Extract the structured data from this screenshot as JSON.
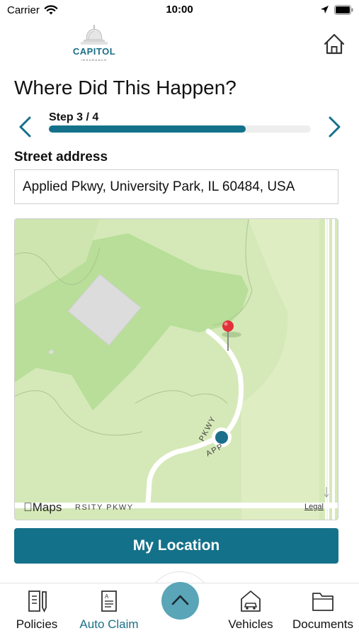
{
  "status_bar": {
    "carrier": "Carrier",
    "time": "10:00"
  },
  "header": {
    "logo_name": "CAPITOL",
    "logo_sub": "INSURANCE",
    "title": "Where Did This Happen?"
  },
  "stepper": {
    "label": "Step 3 / 4",
    "progress_percent": 75
  },
  "address": {
    "label": "Street address",
    "value": "Applied Pkwy, University Park, IL 60484, USA"
  },
  "map": {
    "attribution": "Maps",
    "legal": "Legal",
    "street_bottom": "RSITY PKWY",
    "street_curve": "PKWY",
    "street_lower": "APP"
  },
  "actions": {
    "my_location": "My Location"
  },
  "tab_bar": {
    "items": [
      {
        "label": "Policies",
        "icon": "policy-document-icon",
        "active": false
      },
      {
        "label": "Auto Claim",
        "icon": "auto-claim-icon",
        "active": true
      },
      {
        "label": "Vehicles",
        "icon": "vehicle-garage-icon",
        "active": false
      },
      {
        "label": "Documents",
        "icon": "folder-icon",
        "active": false
      }
    ],
    "center_icon": "chevron-up-icon"
  },
  "colors": {
    "brand": "#14718a",
    "active_tab": "#1a6f86",
    "map_base": "#d5e9b8",
    "map_park": "#b8de99",
    "pin": "#e0313a",
    "location_dot": "#1b6f8b"
  }
}
